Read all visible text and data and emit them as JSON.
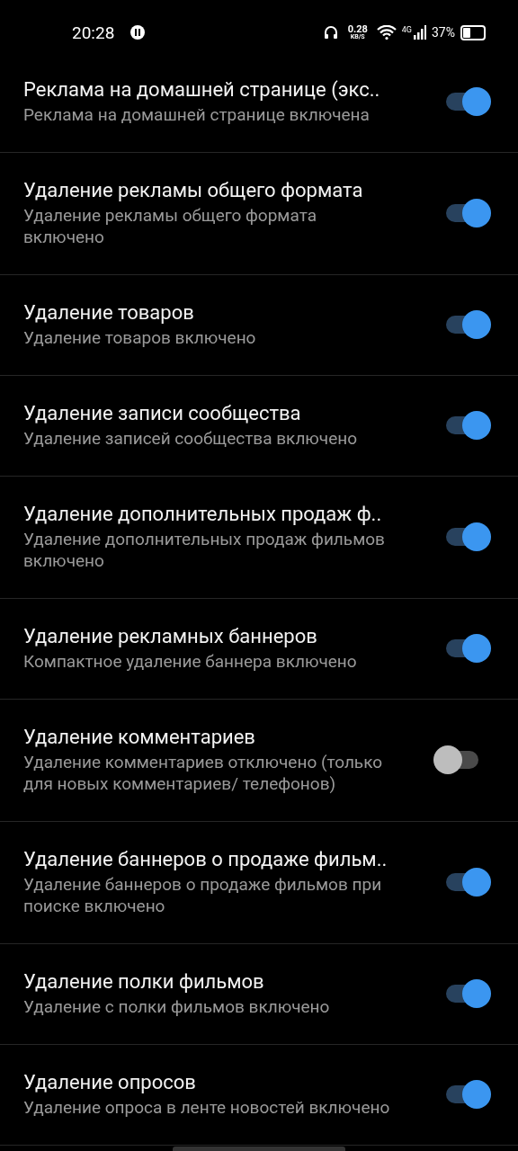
{
  "status_bar": {
    "time": "20:28",
    "speed_value": "0.28",
    "speed_unit": "KB/S",
    "network": "4G",
    "battery": "37%"
  },
  "settings": [
    {
      "title": "Реклама на домашней странице (экс..",
      "subtitle": "Реклама на домашней странице включена",
      "on": true
    },
    {
      "title": "Удаление рекламы общего формата",
      "subtitle": "Удаление рекламы общего формата включено",
      "on": true
    },
    {
      "title": "Удаление товаров",
      "subtitle": "Удаление товаров включено",
      "on": true
    },
    {
      "title": "Удаление записи сообщества",
      "subtitle": "Удаление записей сообщества включено",
      "on": true
    },
    {
      "title": "Удаление дополнительных продаж ф..",
      "subtitle": "Удаление дополнительных продаж фильмов включено",
      "on": true
    },
    {
      "title": "Удаление рекламных баннеров",
      "subtitle": "Компактное удаление баннера включено",
      "on": true
    },
    {
      "title": "Удаление комментариев",
      "subtitle": "Удаление комментариев отключено (только для новых комментариев/ телефонов)",
      "on": false
    },
    {
      "title": "Удаление баннеров о продаже фильм..",
      "subtitle": "Удаление баннеров о продаже фильмов при поиске включено",
      "on": true
    },
    {
      "title": "Удаление полки фильмов",
      "subtitle": "Удаление с полки фильмов включено",
      "on": true
    },
    {
      "title": "Удаление опросов",
      "subtitle": "Удаление опроса в ленте новостей включено",
      "on": true
    }
  ]
}
